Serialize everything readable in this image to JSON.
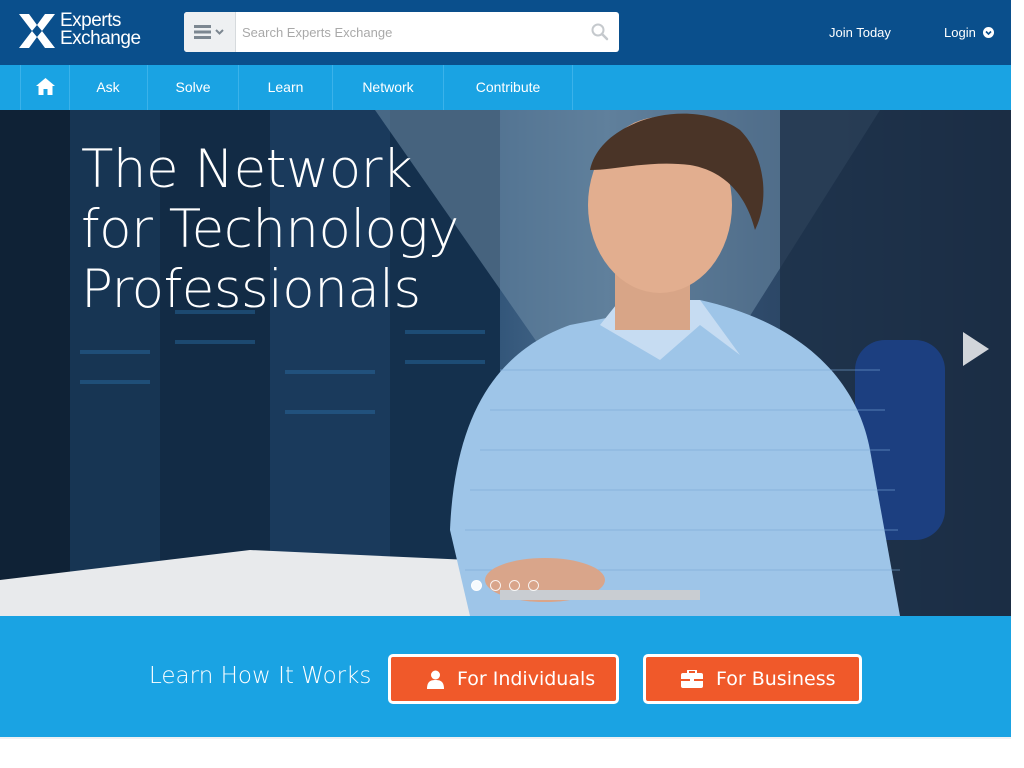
{
  "header": {
    "logo_line1": "Experts",
    "logo_line2": "Exchange",
    "search_placeholder": "Search Experts Exchange",
    "join_label": "Join Today",
    "login_label": "Login"
  },
  "nav": {
    "items": [
      {
        "label": "Ask"
      },
      {
        "label": "Solve"
      },
      {
        "label": "Learn"
      },
      {
        "label": "Network"
      },
      {
        "label": "Contribute"
      }
    ]
  },
  "hero": {
    "title_lines": [
      "The Network",
      "for Technology",
      "Professionals"
    ],
    "slides_count": 4,
    "active_slide": 1
  },
  "cta": {
    "label": "Learn How It Works",
    "individuals_label": "For Individuals",
    "business_label": "For Business"
  },
  "icons": {
    "home": "home-icon",
    "search": "search-icon",
    "menu": "menu-icon",
    "chevron": "chevron-down-icon",
    "next": "next-slide-icon",
    "user": "user-icon",
    "briefcase": "briefcase-icon"
  },
  "colors": {
    "header_bg": "#0a4f8c",
    "nav_bg": "#1aa3e3",
    "cta_button": "#f0592a"
  }
}
